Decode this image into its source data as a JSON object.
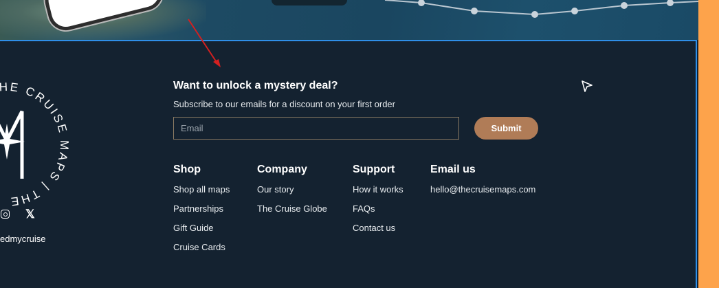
{
  "promo": {
    "title": "Want to unlock a mystery deal?",
    "subtitle": "Subscribe to our emails for a discount on your first order",
    "email_placeholder": "Email",
    "submit_label": "Submit"
  },
  "logo": {
    "ring_text": "THE CRUISE MAPS | THE"
  },
  "social": {
    "handle": "edmycruise"
  },
  "columns": {
    "shop": {
      "heading": "Shop",
      "links": [
        "Shop all maps",
        "Partnerships",
        "Gift Guide",
        "Cruise Cards"
      ]
    },
    "company": {
      "heading": "Company",
      "links": [
        "Our story",
        "The Cruise Globe"
      ]
    },
    "support": {
      "heading": "Support",
      "links": [
        "How it works",
        "FAQs",
        "Contact us"
      ]
    },
    "email": {
      "heading": "Email us",
      "links": [
        "hello@thecruisemaps.com"
      ]
    }
  },
  "colors": {
    "footer_bg": "#142230",
    "button": "#b07c57",
    "accent_border": "#2f8fe8",
    "side_panel": "#fda34b"
  }
}
